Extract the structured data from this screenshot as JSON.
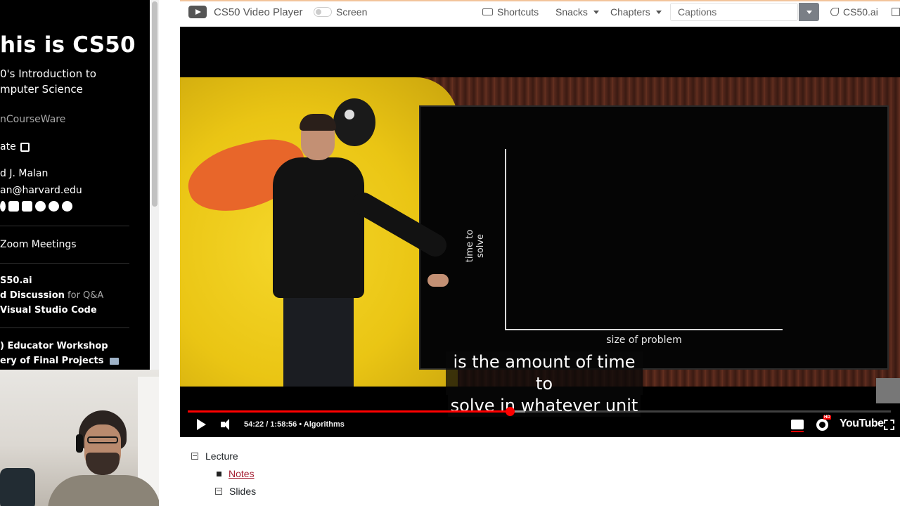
{
  "sidebar": {
    "title": "his is CS50",
    "subtitle_line1": "0's Introduction to",
    "subtitle_line2": "mputer Science",
    "opencourseware": "nCourseWare",
    "donate": "ate",
    "instructor": "d J. Malan",
    "email": "an@harvard.edu",
    "zoom": "Zoom Meetings",
    "cs50ai": "S50.ai",
    "discussion_bold": "d Discussion",
    "discussion_gray": "for Q&A",
    "vscode": "Visual Studio Code",
    "workshop": ") Educator Workshop",
    "final_projects": "ery of Final Projects"
  },
  "navbar": {
    "player_title": "CS50 Video Player",
    "screen_label": "Screen",
    "shortcuts": "Shortcuts",
    "snacks": "Snacks",
    "chapters": "Chapters",
    "captions_placeholder": "Captions",
    "cs50ai": "CS50.ai"
  },
  "video": {
    "board_ylabel": "time to solve",
    "board_xlabel": "size of problem",
    "subtitle_line1": "is the amount of time to",
    "subtitle_line2": "solve in whatever unit",
    "time": "54:22 / 1:58:56",
    "chapter": "Algorithms",
    "youtube": "YouTube",
    "played_fraction": 0.4578,
    "loaded_fraction": 0.48
  },
  "outline": {
    "lecture": "Lecture",
    "notes": "Notes",
    "slides": "Slides"
  },
  "colors": {
    "navbar_accent": "#f2c49b",
    "progress_red": "#ff0000",
    "notes_link": "#a51c30"
  }
}
